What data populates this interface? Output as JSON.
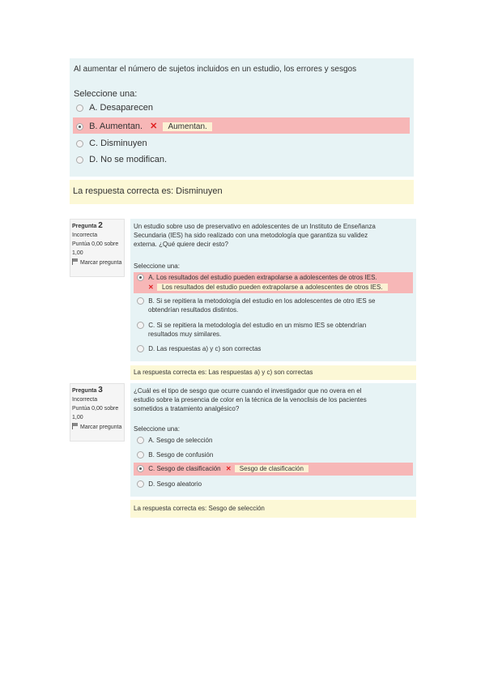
{
  "q1": {
    "stem": "Al aumentar el número de sujetos incluidos en un estudio, los errores y sesgos",
    "select_label": "Seleccione una:",
    "options": [
      "A. Desaparecen",
      "B. Aumentan.",
      "C. Disminuyen",
      "D. No se modifican."
    ],
    "selected_tag": "Aumentan.",
    "feedback": "La respuesta correcta es: Disminuyen"
  },
  "q2": {
    "label": "Pregunta",
    "number": "2",
    "status": "Incorrecta",
    "score": "Puntúa 0,00 sobre 1,00",
    "flag": "Marcar pregunta",
    "stem_line1": "Un estudio sobre uso de preservativo en adolescentes de un Instituto de Enseñanza",
    "stem_line2": "Secundaria (IES) ha sido realizado con una metodología que garantiza su validez",
    "stem_line3": "externa. ¿Qué quiere decir esto?",
    "select_label": "Seleccione una:",
    "opt_a": "A. Los resultados del estudio pueden extrapolarse a adolescentes de otros IES.",
    "opt_a_tag": "Los resultados del estudio pueden extrapolarse a adolescentes de otros IES.",
    "opt_b_line1": "B. Si se repitiera la metodología del estudio en los adolescentes de otro IES se",
    "opt_b_line2": "obtendrían resultados distintos.",
    "opt_c_line1": "C. Si se repitiera la metodología del estudio en un mismo IES se obtendrían",
    "opt_c_line2": "resultados muy similares.",
    "opt_d": "D. Las respuestas a) y c) son correctas",
    "feedback": "La respuesta correcta es: Las respuestas a) y c) son correctas"
  },
  "q3": {
    "label": "Pregunta",
    "number": "3",
    "status": "Incorrecta",
    "score": "Puntúa 0,00 sobre 1,00",
    "flag": "Marcar pregunta",
    "stem_line1": "¿Cuál es el tipo de sesgo que ocurre cuando el investigador que no overa en el",
    "stem_line2": "estudio sobre la presencia de color en la técnica de la venoclisis de los pacientes",
    "stem_line3": "sometidos a tratamiento analgésico?",
    "select_label": "Seleccione una:",
    "options": [
      "A. Sesgo de selección",
      "B. Sesgo de confusión",
      "C. Sesgo de clasificación",
      "D. Sesgo aleatorio"
    ],
    "selected_tag": "Sesgo de clasificación",
    "feedback": "La respuesta correcta es: Sesgo de selección"
  },
  "colors": {
    "question_bg": "#e7f3f5",
    "feedback_bg": "#fcf8d6",
    "incorrect_bg": "#f7b7b7",
    "x_mark": "#e02020"
  },
  "icons": [
    "radio-icon",
    "close-icon",
    "flag-icon"
  ]
}
